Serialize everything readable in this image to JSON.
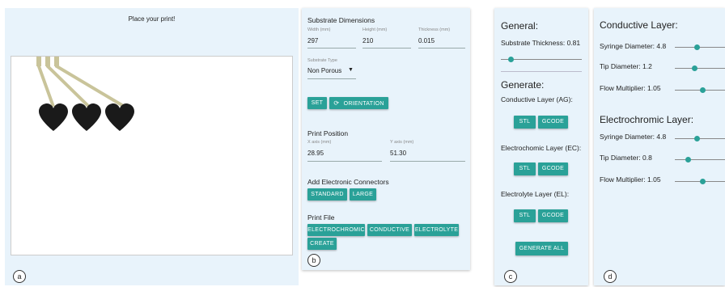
{
  "panel_a": {
    "title": "Place your print!",
    "marker": "a"
  },
  "panel_b": {
    "marker": "b",
    "substrate_title": "Substrate Dimensions",
    "width_label": "Width (mm)",
    "width_value": "297",
    "height_label": "Height (mm)",
    "height_value": "210",
    "thickness_label": "Thickness (mm)",
    "thickness_value": "0.015",
    "type_label": "Substrate Type",
    "type_value": "Non Porous",
    "set_button": "SET",
    "orientation_button": "ORIENTATION",
    "position_title": "Print Position",
    "x_label": "X axis (mm)",
    "x_value": "28.95",
    "y_label": "Y axis (mm)",
    "y_value": "51.30",
    "connectors_title": "Add Electronic Connectors",
    "standard_button": "STANDARD",
    "large_button": "LARGE",
    "print_file_title": "Print File",
    "electrochromic_button": "ELECTROCHROMIC",
    "conductive_button": "CONDUCTIVE",
    "electrolyte_button": "ELECTROLYTE",
    "create_button": "CREATE"
  },
  "panel_c": {
    "marker": "c",
    "general_title": "General:",
    "thickness_label": "Substrate Thickness: 0.81",
    "thickness_level": 0.12,
    "generate_title": "Generate:",
    "conductive_label": "Conductive Layer (AG):",
    "electrochromic_label": "Electrochomic Layer (EC):",
    "electrolyte_label": "Electrolyte Layer (EL):",
    "stl": "STL",
    "gcode": "GCODE",
    "generate_all": "GENERATE ALL"
  },
  "panel_d": {
    "marker": "d",
    "conductive_title": "Conductive Layer:",
    "electrochromic_title": "Electrochromic Layer:",
    "c_syringe": "Syringe Diameter: 4.8",
    "c_tip": "Tip Diameter: 1.2",
    "c_flow": "Flow Multiplier: 1.05",
    "e_syringe": "Syringe Diameter: 4.8",
    "e_tip": "Tip Diameter: 0.8",
    "e_flow": "Flow Multiplier: 1.05"
  },
  "colors": {
    "accent": "#2aa198",
    "panel_bg": "#e8f3fb",
    "heart": "#1a1a1a",
    "trace": "#c9c49a"
  }
}
